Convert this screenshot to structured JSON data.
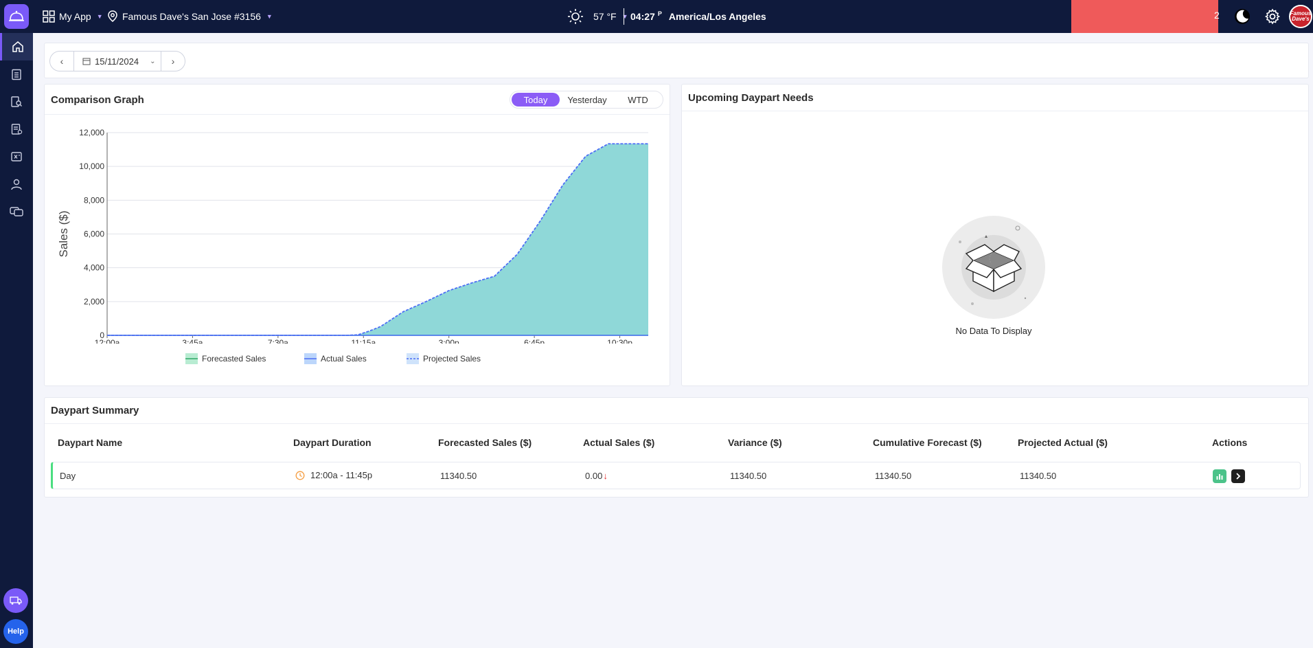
{
  "topbar": {
    "app_label": "My App",
    "location": "Famous Dave's San Jose #3156",
    "temperature": "57 °F",
    "time": "04:27",
    "time_suffix": "P",
    "timezone": "America/Los Angeles",
    "red_counter": "2",
    "avatar_text": "Famous Dave's"
  },
  "sidebar": {
    "items": [
      "home-icon",
      "clipboard-icon",
      "report-search-icon",
      "checklist-icon",
      "calculator-icon",
      "user-icon",
      "chat-icon"
    ],
    "help_label": "Help"
  },
  "date_nav": {
    "date": "15/11/2024"
  },
  "comparison": {
    "title": "Comparison Graph",
    "tabs": [
      "Today",
      "Yesterday",
      "WTD"
    ],
    "active_tab": "Today"
  },
  "upcoming": {
    "title": "Upcoming Daypart Needs",
    "empty_text": "No Data To Display"
  },
  "chart_data": {
    "type": "area",
    "ylabel": "Sales ($)",
    "xlabel": "",
    "ylim": [
      0,
      12000
    ],
    "yticks": [
      "0",
      "2,000",
      "4,000",
      "6,000",
      "8,000",
      "10,000",
      "12,000"
    ],
    "xticks": [
      "12:00a",
      "3:45a",
      "7:30a",
      "11:15a",
      "3:00p",
      "6:45p",
      "10:30p"
    ],
    "x_minutes": [
      0,
      105,
      210,
      315,
      420,
      525,
      630,
      660,
      690,
      720,
      780,
      840,
      900,
      960,
      1020,
      1080,
      1140,
      1200,
      1260,
      1320,
      1380,
      1425
    ],
    "series": [
      {
        "name": "Forecasted Sales",
        "values": [
          0,
          0,
          0,
          0,
          0,
          0,
          0,
          0,
          0,
          0,
          0,
          0,
          0,
          0,
          0,
          0,
          0,
          0,
          0,
          0,
          0,
          0
        ],
        "color": "#4fc3a1"
      },
      {
        "name": "Actual Sales",
        "values": [
          0,
          0,
          0,
          0,
          0,
          0,
          0,
          0,
          0,
          0,
          0,
          0,
          0,
          0,
          0,
          0,
          0,
          0,
          0,
          0,
          0,
          0
        ],
        "color": "#4c6ef5"
      },
      {
        "name": "Projected Sales",
        "values": [
          0,
          0,
          0,
          0,
          0,
          0,
          0,
          30,
          250,
          520,
          1400,
          2000,
          2650,
          3100,
          3500,
          4800,
          6750,
          8900,
          10600,
          11340.5,
          11340.5,
          11340.5
        ],
        "color": "#4c6ef5"
      }
    ],
    "fill_color": "#8fd8d8",
    "legend": [
      "Forecasted Sales",
      "Actual Sales",
      "Projected Sales"
    ],
    "legend_position": "bottom",
    "grid": true
  },
  "summary": {
    "title": "Daypart Summary",
    "headers": [
      "Daypart Name",
      "Daypart Duration",
      "Forecasted Sales ($)",
      "Actual Sales ($)",
      "Variance ($)",
      "Cumulative Forecast ($)",
      "Projected Actual ($)",
      "Actions"
    ],
    "rows": [
      {
        "name": "Day",
        "duration": "12:00a - 11:45p",
        "forecasted": "11340.50",
        "actual": "0.00",
        "variance": "11340.50",
        "cumulative": "11340.50",
        "projected": "11340.50"
      }
    ]
  }
}
